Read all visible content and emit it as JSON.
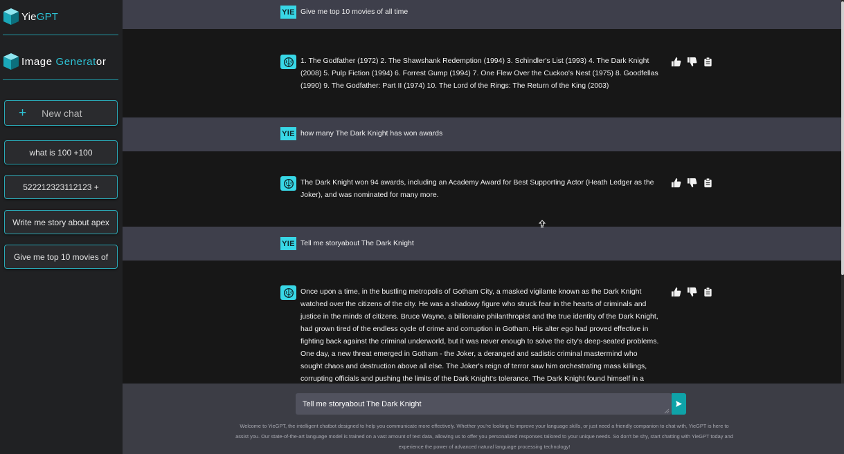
{
  "sidebar": {
    "brand1": {
      "prefix": "Yie",
      "suffix": "GPT"
    },
    "brand2": {
      "part1": "Image ",
      "part2": "Generat",
      "part3": "or"
    },
    "new_chat": {
      "icon": "+",
      "label": "New chat"
    },
    "history": [
      "what is 100 +100",
      "522212323112123 +",
      "Write me story about apex",
      "Give me top 10 movies of"
    ]
  },
  "chat": {
    "user_avatar_label": "YIE",
    "messages": [
      {
        "role": "user",
        "text": "Give me top 10 movies of all time"
      },
      {
        "role": "bot",
        "text": "1. The Godfather (1972) 2. The Shawshank Redemption (1994) 3. Schindler's List (1993) 4. The Dark Knight (2008) 5. Pulp Fiction (1994) 6. Forrest Gump (1994) 7. One Flew Over the Cuckoo's Nest (1975) 8. Goodfellas (1990) 9. The Godfather: Part II (1974) 10. The Lord of the Rings: The Return of the King (2003)"
      },
      {
        "role": "user",
        "text": "how many The Dark Knight has won awards"
      },
      {
        "role": "bot",
        "text": "The Dark Knight won 94 awards, including an Academy Award for Best Supporting Actor (Heath Ledger as the Joker), and was nominated for many more."
      },
      {
        "role": "user",
        "text": "Tell me storyabout The Dark Knight"
      },
      {
        "role": "bot",
        "text": "Once upon a time, in the bustling metropolis of Gotham City, a masked vigilante known as the Dark Knight watched over the citizens of the city. He was a shadowy figure who struck fear in the hearts of criminals and justice in the minds of citizens. Bruce Wayne, a billionaire philanthropist and the true identity of the Dark Knight, had grown tired of the endless cycle of crime and corruption in Gotham. His alter ego had proved effective in fighting back against the criminal underworld, but it was never enough to solve the city's deep-seated problems. One day, a new threat emerged in Gotham - the Joker, a deranged and sadistic criminal mastermind who sought chaos and destruction above all else. The Joker's reign of terror saw him orchestrating mass killings, corrupting officials and pushing the limits of the Dark Knight's tolerance. The Dark Knight found himself in a desperate struggle to protect the people"
      }
    ]
  },
  "input": {
    "value": "Tell me storyabout The Dark Knight"
  },
  "footer": {
    "text": "Welcome to YieGPT, the intelligent chatbot designed to help you communicate more effectively. Whether you're looking to improve your language skills, or just need a friendly companion to chat with, YieGPT is here to assist you. Our state-of-the-art language model is trained on a vast amount of text data, allowing us to offer you personalized responses tailored to your unique needs. So don't be shy, start chatting with YieGPT today and experience the power of advanced natural language processing technology!"
  },
  "colors": {
    "accent": "#2ec4d6",
    "user_row": "#3e3f4b",
    "bot_row": "#171717",
    "sidebar": "#202123",
    "send": "#0fa3a8"
  },
  "icons": [
    "cube-logo-icon",
    "plus-icon",
    "bot-brain-icon",
    "thumbs-up-icon",
    "thumbs-down-icon",
    "clipboard-icon",
    "send-icon"
  ]
}
